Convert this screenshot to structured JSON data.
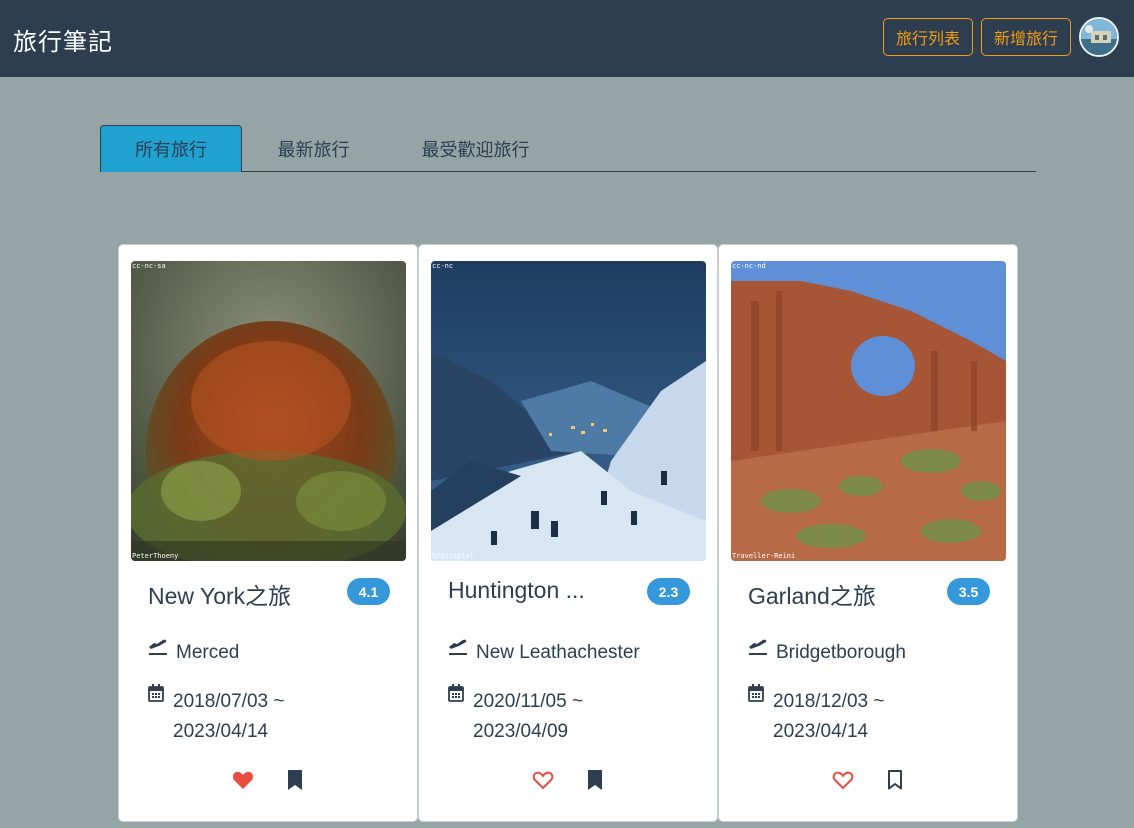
{
  "navbar": {
    "brand": "旅行筆記",
    "list_label": "旅行列表",
    "add_label": "新增旅行"
  },
  "tabs": [
    {
      "label": "所有旅行",
      "active": true
    },
    {
      "label": "最新旅行",
      "active": false
    },
    {
      "label": "最受歡迎旅行",
      "active": false
    }
  ],
  "cards": [
    {
      "title": "New York之旅",
      "rating": "4.1",
      "destination": "Merced",
      "date_start": "2018/07/03 ~",
      "date_end": "2023/04/14",
      "image_license": "cc-nc-sa",
      "image_credit": "PeterThoeny",
      "liked": true,
      "bookmarked": true
    },
    {
      "title": "Huntington ...",
      "rating": "2.3",
      "destination": "New Leathachester",
      "date_start": "2020/11/05 ~",
      "date_end": "2023/04/09",
      "image_license": "cc-nc",
      "image_credit": "bratispixl",
      "liked": false,
      "bookmarked": true
    },
    {
      "title": "Garland之旅",
      "rating": "3.5",
      "destination": "Bridgetborough",
      "date_start": "2018/12/03 ~",
      "date_end": "2023/04/14",
      "image_license": "cc-nc-nd",
      "image_credit": "Traveller-Reini",
      "liked": false,
      "bookmarked": false
    }
  ],
  "colors": {
    "navbar": "#2c3e50",
    "background": "#95a5a6",
    "accent_orange": "#f39c12",
    "active_tab": "#1fa2d0",
    "badge": "#3498db",
    "heart": "#e74c3c"
  }
}
